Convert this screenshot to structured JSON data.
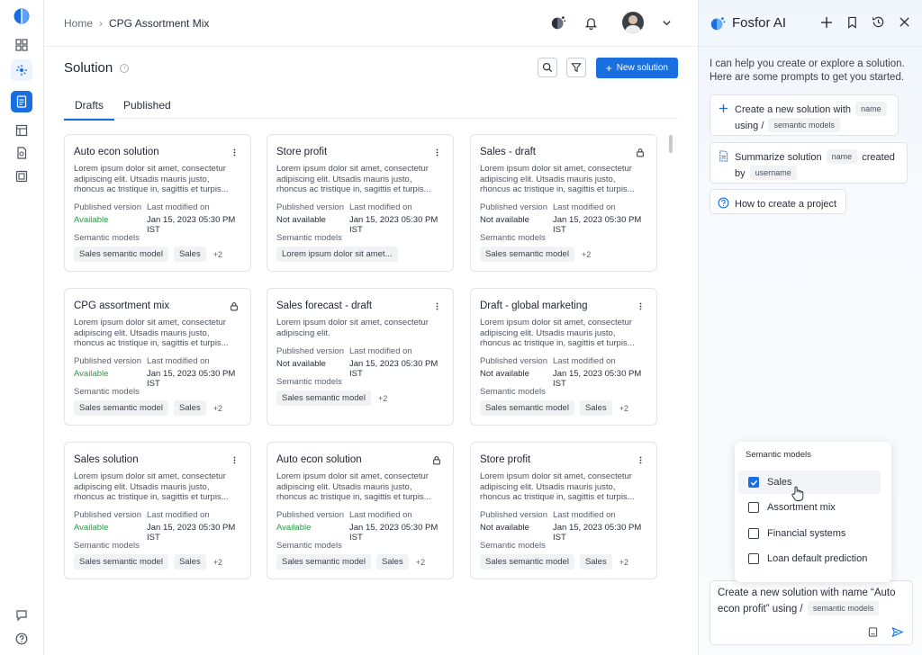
{
  "breadcrumb": {
    "home": "Home",
    "current": "CPG Assortment Mix"
  },
  "header": {
    "title": "Solution",
    "new_button": "New solution"
  },
  "tabs": [
    {
      "label": "Drafts",
      "active": true
    },
    {
      "label": "Published",
      "active": false
    }
  ],
  "labels": {
    "published_version": "Published version",
    "last_modified": "Last modified on",
    "semantic_models": "Semantic models"
  },
  "cards": [
    {
      "title": "Auto econ solution",
      "icon": "kebab-icon",
      "desc": "Lorem ipsum dolor sit amet, consectetur adipiscing elit. Utsadis mauris justo, rhoncus ac tristique in, sagittis et turpis...",
      "status": "Available",
      "modified": "Jan 15, 2023 05:30 PM IST",
      "chips": [
        "Sales semantic model",
        "Sales"
      ],
      "more": "+2"
    },
    {
      "title": "Store profit",
      "icon": "kebab-icon",
      "desc": "Lorem ipsum dolor sit amet, consectetur adipiscing elit. Utsadis mauris justo, rhoncus ac tristique in, sagittis et turpis...",
      "status": "Not available",
      "modified": "Jan 15, 2023 05:30 PM IST",
      "chips": [
        "Lorem ipsum dolor sit amet..."
      ],
      "more": ""
    },
    {
      "title": "Sales - draft",
      "icon": "lock-icon",
      "desc": "Lorem ipsum dolor sit amet, consectetur adipiscing elit. Utsadis mauris justo, rhoncus ac tristique in, sagittis et turpis...",
      "status": "Not available",
      "modified": "Jan 15, 2023 05:30 PM IST",
      "chips": [
        "Sales semantic model"
      ],
      "more": "+2"
    },
    {
      "title": "CPG assortment mix",
      "icon": "lock-icon",
      "desc": "Lorem ipsum dolor sit amet, consectetur adipiscing elit. Utsadis mauris justo, rhoncus ac tristique in, sagittis et turpis...",
      "status": "Available",
      "modified": "Jan 15, 2023 05:30 PM IST",
      "chips": [
        "Sales semantic model",
        "Sales"
      ],
      "more": "+2"
    },
    {
      "title": "Sales forecast - draft",
      "icon": "kebab-icon",
      "desc": "Lorem ipsum dolor sit amet, consectetur adipiscing elit.",
      "status": "Not available",
      "modified": "Jan 15, 2023 05:30 PM IST",
      "chips": [
        "Sales semantic model"
      ],
      "more": "+2"
    },
    {
      "title": "Draft - global marketing",
      "icon": "kebab-icon",
      "desc": "Lorem ipsum dolor sit amet, consectetur adipiscing elit. Utsadis mauris justo, rhoncus ac tristique in, sagittis et turpis...",
      "status": "Not available",
      "modified": "Jan 15, 2023 05:30 PM IST",
      "chips": [
        "Sales semantic model",
        "Sales"
      ],
      "more": "+2"
    },
    {
      "title": "Sales solution",
      "icon": "kebab-icon",
      "desc": "Lorem ipsum dolor sit amet, consectetur adipiscing elit. Utsadis mauris justo, rhoncus ac tristique in, sagittis et turpis...",
      "status": "Available",
      "modified": "Jan 15, 2023 05:30 PM IST",
      "chips": [
        "Sales semantic model",
        "Sales"
      ],
      "more": "+2"
    },
    {
      "title": "Auto econ solution",
      "icon": "lock-icon",
      "desc": "Lorem ipsum dolor sit amet, consectetur adipiscing elit. Utsadis mauris justo, rhoncus ac tristique in, sagittis et turpis...",
      "status": "Available",
      "modified": "Jan 15, 2023 05:30 PM IST",
      "chips": [
        "Sales semantic model",
        "Sales"
      ],
      "more": "+2"
    },
    {
      "title": "Store profit",
      "icon": "kebab-icon",
      "desc": "Lorem ipsum dolor sit amet, consectetur adipiscing elit. Utsadis mauris justo, rhoncus ac tristique in, sagittis et turpis...",
      "status": "Not available",
      "modified": "Jan 15, 2023 05:30 PM IST",
      "chips": [
        "Sales semantic model",
        "Sales"
      ],
      "more": "+2"
    }
  ],
  "ai": {
    "name": "Fosfor AI",
    "intro": "I can help you create or explore a solution. Here are some prompts to get you started.",
    "prompt1": {
      "a": "Create a new solution with",
      "tag1": "name",
      "b": "using /",
      "tag2": "semantic models"
    },
    "prompt2": {
      "a": "Summarize solution",
      "tag1": "name",
      "b": "created",
      "c": "by",
      "tag2": "username"
    },
    "prompt3": "How to create a project",
    "dropdown": {
      "title": "Semantic models",
      "items": [
        {
          "label": "Sales",
          "checked": true
        },
        {
          "label": "Assortment mix",
          "checked": false
        },
        {
          "label": "Financial systems",
          "checked": false
        },
        {
          "label": "Loan default prediction",
          "checked": false
        }
      ]
    },
    "composer": {
      "text": "Create a new solution with name “Auto econ profit” using /",
      "tag": "semantic models"
    }
  },
  "colors": {
    "accent": "#1a6fe0",
    "available": "#2a9a48"
  }
}
